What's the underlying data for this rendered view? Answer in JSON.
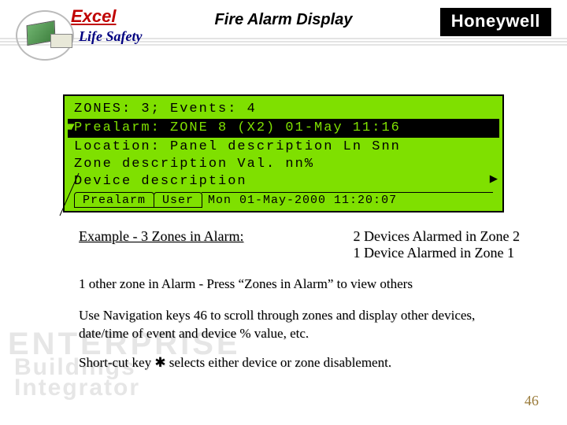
{
  "header": {
    "brand_top": "Excel",
    "brand_sub": "Life Safety",
    "title": "Fire Alarm Display",
    "vendor": "Honeywell"
  },
  "display": {
    "line1": "ZONES: 3; Events: 4",
    "line2": "Prealarm: ZONE    8 (X2)    01-May 11:16",
    "line3": "Location: Panel description      Ln Snn",
    "line4": "Zone description              Val. nn%",
    "line5": "Device description",
    "tab1": "Prealarm",
    "tab2": "User",
    "status_time": "Mon 01-May-2000 11:20:07"
  },
  "caption": {
    "left": "Example - 3 Zones in Alarm:",
    "right_l1": "2 Devices Alarmed in Zone 2",
    "right_l2": "1 Device Alarmed in Zone 1"
  },
  "body": {
    "p1": "1 other zone in Alarm -   Press “Zones in Alarm” to view others",
    "p2": "Use Navigation keys 46 to scroll through zones and display other devices, date/time of event and device % value, etc.",
    "p3": "Short-cut key ✱ selects either device or zone disablement."
  },
  "slide_number": "46",
  "watermark": {
    "l1": "ENTERPRISE",
    "l2": "Buildings",
    "l3": "Integrator"
  }
}
